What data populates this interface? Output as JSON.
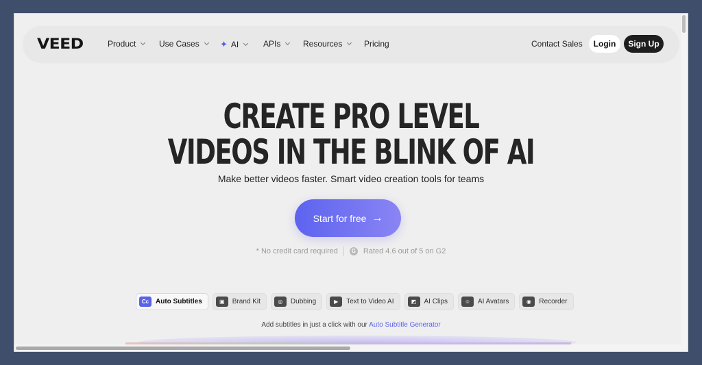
{
  "nav": {
    "logo": "VEED",
    "items": [
      {
        "label": "Product",
        "has_dropdown": true
      },
      {
        "label": "Use Cases",
        "has_dropdown": true
      },
      {
        "label": "AI",
        "has_dropdown": true,
        "icon": "sparkle-icon"
      },
      {
        "label": "APIs",
        "has_dropdown": true
      },
      {
        "label": "Resources",
        "has_dropdown": true
      },
      {
        "label": "Pricing",
        "has_dropdown": false
      }
    ],
    "contact_sales": "Contact Sales",
    "login": "Login",
    "signup": "Sign Up"
  },
  "hero": {
    "headline_line1": "CREATE PRO LEVEL",
    "headline_line2": "VIDEOS IN THE BLINK OF AI",
    "subtitle": "Make better videos faster. Smart video creation tools for teams",
    "cta": "Start for free",
    "cta_arrow": "→",
    "note_left": "* No credit card required",
    "rating_badge": "G",
    "note_right": "Rated 4.6 out of 5 on G2"
  },
  "tools": {
    "tabs": [
      {
        "label": "Auto Subtitles",
        "icon": "Cc",
        "active": true
      },
      {
        "label": "Brand Kit",
        "icon": "▣",
        "active": false
      },
      {
        "label": "Dubbing",
        "icon": "◎",
        "active": false
      },
      {
        "label": "Text to Video AI",
        "icon": "▶",
        "active": false
      },
      {
        "label": "AI Clips",
        "icon": "◩",
        "active": false
      },
      {
        "label": "AI Avatars",
        "icon": "☺",
        "active": false
      },
      {
        "label": "Recorder",
        "icon": "◉",
        "active": false
      }
    ],
    "description_prefix": "Add subtitles in just a click with our ",
    "description_link": "Auto Subtitle Generator"
  },
  "colors": {
    "background": "#3f4f6b",
    "accent": "#5b62ea",
    "page": "#efefef"
  }
}
